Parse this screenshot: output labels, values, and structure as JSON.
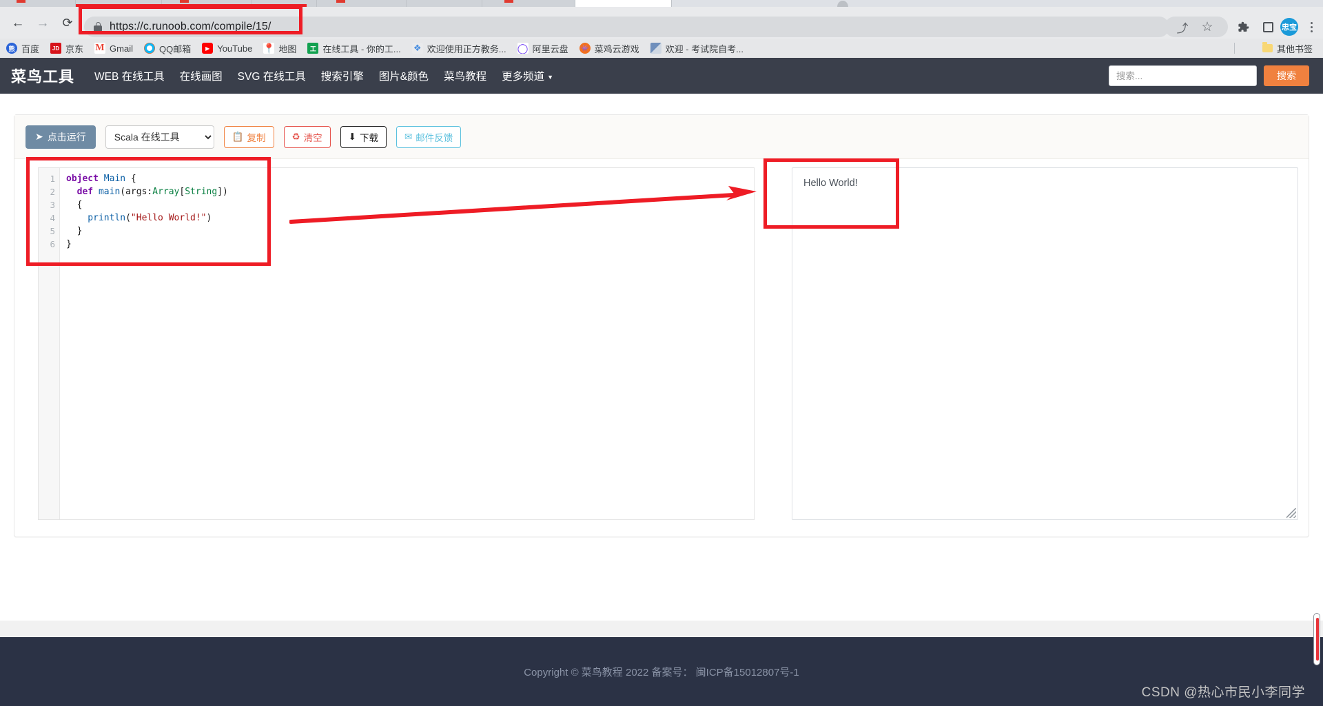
{
  "browser": {
    "url": "https://c.runoob.com/compile/15/",
    "back_icon": "←",
    "forward_icon": "→",
    "reload_icon": "⟳",
    "lock_icon": "lock-icon",
    "share_icon": "⤴",
    "star_icon": "☆",
    "extensions_icon": "🧩",
    "side_panel_icon": "side-panel-icon",
    "avatar_label": "忠宝",
    "menu_icon": "⋮",
    "bookmarks": [
      {
        "label": "百度",
        "icon_class": "ico-baidu",
        "glyph": "熊"
      },
      {
        "label": "京东",
        "icon_class": "ico-jd",
        "glyph": "JD"
      },
      {
        "label": "Gmail",
        "icon_class": "ico-gmail",
        "glyph": "M"
      },
      {
        "label": "QQ邮箱",
        "icon_class": "ico-qq",
        "glyph": ""
      },
      {
        "label": "YouTube",
        "icon_class": "ico-yt",
        "glyph": "▶"
      },
      {
        "label": "地图",
        "icon_class": "ico-map",
        "glyph": "📍"
      },
      {
        "label": "在线工具 - 你的工...",
        "icon_class": "ico-tool",
        "glyph": "工"
      },
      {
        "label": "欢迎使用正方教务...",
        "icon_class": "ico-zf",
        "glyph": "❖"
      },
      {
        "label": "阿里云盘",
        "icon_class": "ico-ali",
        "glyph": "◯"
      },
      {
        "label": "菜鸡云游戏",
        "icon_class": "ico-cj",
        "glyph": "👾"
      },
      {
        "label": "欢迎 - 考试院自考...",
        "icon_class": "ico-ks",
        "glyph": ""
      }
    ],
    "other_bookmarks_label": "其他书签"
  },
  "site": {
    "brand": "菜鸟工具",
    "nav_items": [
      {
        "label": "WEB 在线工具",
        "has_caret": false
      },
      {
        "label": "在线画图",
        "has_caret": false
      },
      {
        "label": "SVG 在线工具",
        "has_caret": false
      },
      {
        "label": "搜索引擎",
        "has_caret": false
      },
      {
        "label": "图片&颜色",
        "has_caret": false
      },
      {
        "label": "菜鸟教程",
        "has_caret": false
      },
      {
        "label": "更多频道",
        "has_caret": true
      }
    ],
    "caret_glyph": "▼",
    "search": {
      "placeholder": "搜索...",
      "value": "",
      "button_label": "搜索"
    }
  },
  "toolbar": {
    "run_label": "点击运行",
    "run_icon": "➤",
    "language_selected": "Scala 在线工具",
    "language_options": [
      "Scala 在线工具"
    ],
    "buttons": [
      {
        "label": "复制",
        "icon": "📋",
        "style": "btn-copy"
      },
      {
        "label": "清空",
        "icon": "♻",
        "style": "btn-clear"
      },
      {
        "label": "下载",
        "icon": "⬇",
        "style": "btn-down"
      },
      {
        "label": "邮件反馈",
        "icon": "✉",
        "style": "btn-mail"
      }
    ]
  },
  "editor": {
    "line_numbers": [
      "1",
      "2",
      "3",
      "4",
      "5",
      "6"
    ],
    "code_lines": [
      [
        {
          "t": "object ",
          "c": "kw"
        },
        {
          "t": "Main",
          "c": "fn"
        },
        {
          "t": " {",
          "c": "pl"
        }
      ],
      [
        {
          "t": "  def ",
          "c": "kw"
        },
        {
          "t": "main",
          "c": "fn"
        },
        {
          "t": "(args:",
          "c": "pl"
        },
        {
          "t": "Array",
          "c": "ty"
        },
        {
          "t": "[",
          "c": "pl"
        },
        {
          "t": "String",
          "c": "ty"
        },
        {
          "t": "])",
          "c": "pl"
        }
      ],
      [
        {
          "t": "  {",
          "c": "pl"
        }
      ],
      [
        {
          "t": "    println",
          "c": "fn"
        },
        {
          "t": "(",
          "c": "pl"
        },
        {
          "t": "\"Hello World!\"",
          "c": "st"
        },
        {
          "t": ")",
          "c": "pl"
        }
      ],
      [
        {
          "t": "  }",
          "c": "pl"
        }
      ],
      [
        {
          "t": "}",
          "c": "pl"
        }
      ]
    ],
    "plain_code": "object Main {\n  def main(args:Array[String])\n  {\n    println(\"Hello World!\")\n  }\n}"
  },
  "output": {
    "text": "Hello World!",
    "resize_handle": "resize-grip-icon"
  },
  "footer": {
    "copyright": "Copyright © 菜鸟教程 2022 备案号： 闽ICP备15012807号-1"
  },
  "watermark": {
    "text": "CSDN @热心市民小李同学"
  },
  "annotations": {
    "colors": {
      "highlight": "#ee1c25",
      "accent": "#f0813f",
      "navbar": "#3a3f4b",
      "footer": "#2b3245"
    },
    "boxes": [
      "url-bar-highlight",
      "code-editor-highlight",
      "output-panel-highlight"
    ],
    "arrow": "red-arrow-pointing-right"
  }
}
